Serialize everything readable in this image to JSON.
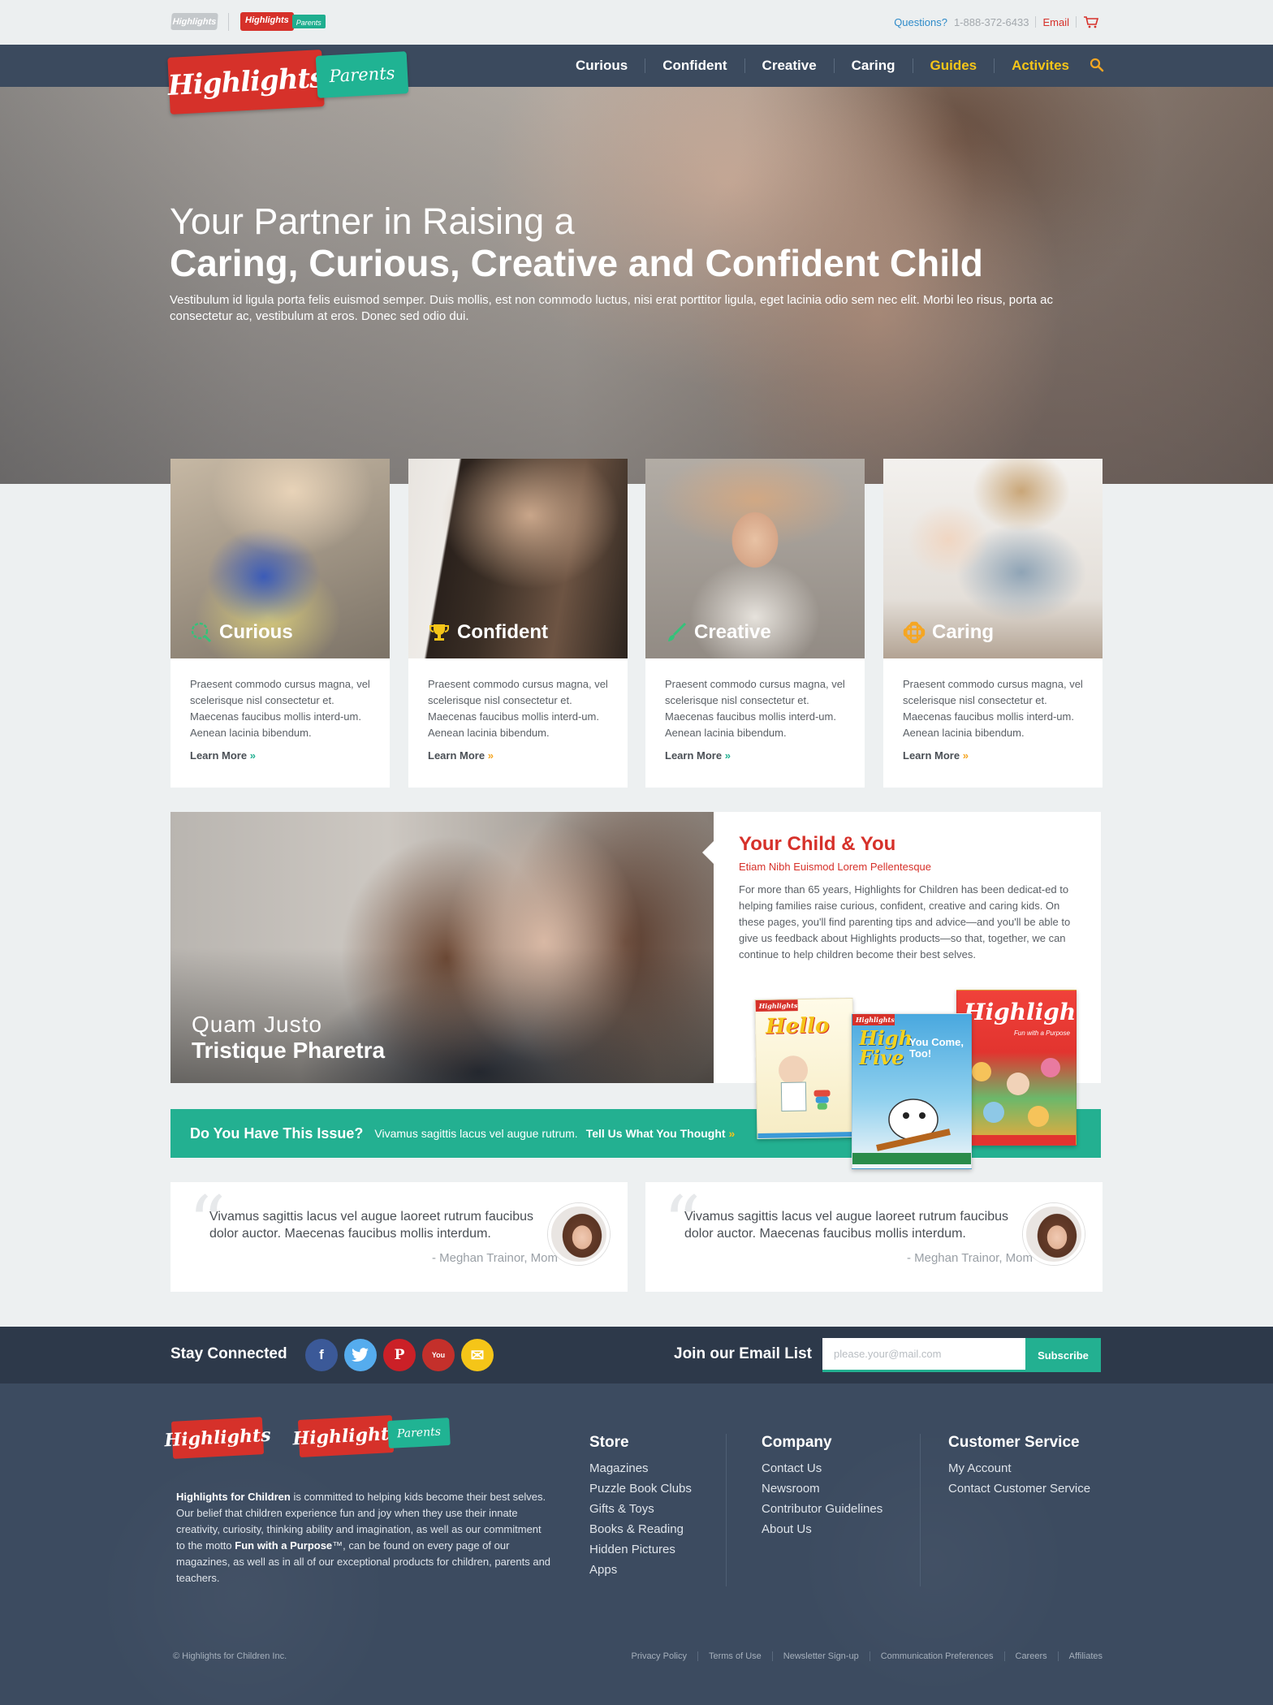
{
  "utility": {
    "logo_main": "Highlights",
    "logo_parents_red": "Highlights",
    "logo_parents_green": "Parents",
    "questions": "Questions?",
    "phone": "1-888-372-6433",
    "email": "Email",
    "cart_icon": "cart-icon"
  },
  "nav": {
    "logo_red": "Highlights",
    "logo_green": "Parents",
    "items": [
      {
        "label": "Curious",
        "color": "#ffffff"
      },
      {
        "label": "Confident",
        "color": "#ffffff"
      },
      {
        "label": "Creative",
        "color": "#ffffff"
      },
      {
        "label": "Caring",
        "color": "#ffffff"
      },
      {
        "label": "Guides",
        "color": "#f5c518"
      },
      {
        "label": "Activites",
        "color": "#f5c518"
      }
    ],
    "search_icon": "search-icon"
  },
  "hero": {
    "line1": "Your Partner in Raising a",
    "line2": "Caring, Curious, Creative and Confident Child",
    "description": "Vestibulum id ligula porta felis euismod semper. Duis mollis, est non commodo luctus, nisi erat porttitor ligula, eget lacinia odio sem nec elit. Morbi leo risus, porta ac consectetur ac, vestibulum at eros. Donec sed odio dui."
  },
  "cards": [
    {
      "title": "Curious",
      "icon": "curious-icon",
      "text": "Praesent commodo cursus magna, vel scelerisque nisl consectetur et. Maecenas faucibus mollis interd-um. Aenean lacinia bibendum.",
      "link": "Learn More",
      "arrow": "»",
      "arrow_color": "#23b091"
    },
    {
      "title": "Confident",
      "icon": "trophy-icon",
      "text": "Praesent commodo cursus magna, vel scelerisque nisl consectetur et. Maecenas faucibus mollis interd-um. Aenean lacinia bibendum.",
      "link": "Learn More",
      "arrow": "»",
      "arrow_color": "#f5a623"
    },
    {
      "title": "Creative",
      "icon": "paintbrush-icon",
      "text": "Praesent commodo cursus magna, vel scelerisque nisl consectetur et. Maecenas faucibus mollis interd-um. Aenean lacinia bibendum.",
      "link": "Learn More",
      "arrow": "»",
      "arrow_color": "#23b091"
    },
    {
      "title": "Caring",
      "icon": "caring-icon",
      "text": "Praesent commodo cursus magna, vel scelerisque nisl consectetur et. Maecenas faucibus mollis interd-um. Aenean lacinia bibendum.",
      "link": "Learn More",
      "arrow": "»",
      "arrow_color": "#f5a623"
    }
  ],
  "feature": {
    "caption_line1": "Quam Justo",
    "caption_line2": "Tristique Pharetra",
    "title": "Your Child & You",
    "subtitle": "Etiam Nibh Euismod Lorem Pellentesque",
    "body": "For more than 65 years, Highlights for Children has been dedicat-ed to helping families raise curious, confident, creative and caring kids. On these pages, you'll find parenting tips and advice—and you'll be able to give us feedback about Highlights products—so that, together, we can continue to help children become their best selves."
  },
  "magazines": {
    "hello_brand": "Highlights",
    "hello_title": "Hello",
    "highfive_brand": "Highlights",
    "highfive_title": "High Five",
    "highfive_tag": "You Come, Too!",
    "highlights_title": "Highlights",
    "highlights_tag": "Fun with a Purpose"
  },
  "issue": {
    "question": "Do You Have This Issue?",
    "text": "Vivamus sagittis lacus vel augue  rutrum.",
    "cta": "Tell Us What You Thought",
    "cta_arrow": "»"
  },
  "testimonials": [
    {
      "quote": "Vivamus sagittis lacus vel augue laoreet rutrum faucibus dolor auctor. Maecenas faucibus mollis interdum.",
      "author": "- Meghan Trainor, Mom"
    },
    {
      "quote": "Vivamus sagittis lacus vel augue laoreet rutrum faucibus dolor auctor. Maecenas faucibus mollis interdum.",
      "author": "- Meghan Trainor, Mom"
    }
  ],
  "connect": {
    "label": "Stay Connected",
    "social": [
      {
        "name": "facebook-icon",
        "glyph": "f",
        "color": "#3b5998"
      },
      {
        "name": "twitter-icon",
        "glyph": "🐦",
        "color": "#55acee"
      },
      {
        "name": "pinterest-icon",
        "glyph": "P",
        "color": "#cb2027"
      },
      {
        "name": "youtube-icon",
        "glyph": "You",
        "color": "#c4302b"
      },
      {
        "name": "email-icon",
        "glyph": "✉",
        "color": "#f5c518"
      }
    ],
    "email_label": "Join our Email List",
    "email_placeholder": "please.your@mail.com",
    "subscribe": "Subscribe"
  },
  "footer": {
    "logo1": "Highlights",
    "logo2_red": "Highlights",
    "logo2_green": "Parents",
    "about_bold": "Highlights for Children",
    "about_text_1": " is committed to helping kids become their best selves. Our belief that children experience fun and joy when they use their innate creativity, curiosity, thinking ability and imagination, as well as our commitment to the motto ",
    "about_bold_2": "Fun with a Purpose",
    "about_text_2": "™, can be found on every page of our magazines, as well as in all of our exceptional products for children, parents and teachers.",
    "columns": [
      {
        "title": "Store",
        "links": [
          "Magazines",
          "Puzzle Book Clubs",
          "Gifts & Toys",
          "Books & Reading",
          "Hidden Pictures",
          "Apps"
        ]
      },
      {
        "title": "Company",
        "links": [
          "Contact Us",
          "Newsroom",
          "Contributor Guidelines",
          "About Us"
        ]
      },
      {
        "title": "Customer Service",
        "links": [
          "My Account",
          "Contact Customer Service"
        ]
      }
    ],
    "copyright": "© Highlights for Children Inc.",
    "legal": [
      "Privacy Policy",
      "Terms of Use",
      "Newsletter Sign-up",
      "Communication Preferences",
      "Careers",
      "Affiliates"
    ]
  }
}
